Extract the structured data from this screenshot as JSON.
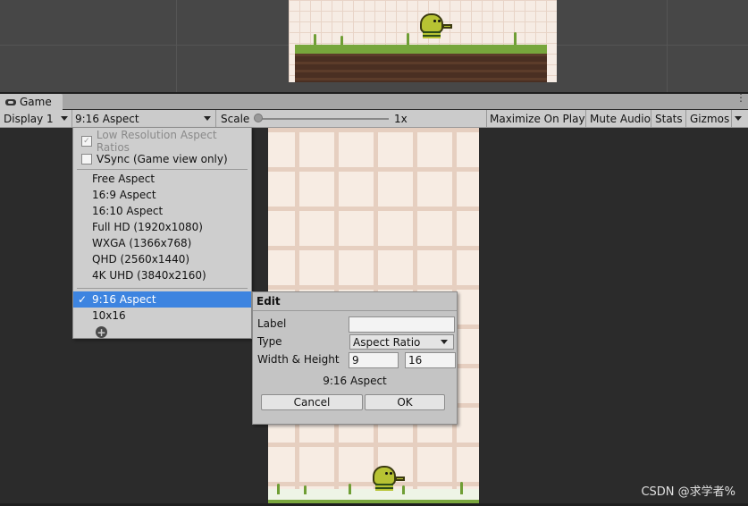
{
  "tab": {
    "title": "Game"
  },
  "toolbar": {
    "display": "Display 1",
    "aspect": "9:16 Aspect",
    "scale_label": "Scale",
    "scale_value": "1x",
    "maximize": "Maximize On Play",
    "mute": "Mute Audio",
    "stats": "Stats",
    "gizmos": "Gizmos"
  },
  "dropdown": {
    "low_res": "Low Resolution Aspect Ratios",
    "vsync": "VSync (Game view only)",
    "items": [
      "Free Aspect",
      "16:9 Aspect",
      "16:10 Aspect",
      "Full HD (1920x1080)",
      "WXGA (1366x768)",
      "QHD (2560x1440)",
      "4K UHD (3840x2160)"
    ],
    "custom_items": [
      "9:16 Aspect",
      "10x16"
    ],
    "check_glyph": "✓",
    "add_glyph": "+"
  },
  "edit": {
    "title": "Edit",
    "label_label": "Label",
    "label_value": "",
    "type_label": "Type",
    "type_value": "Aspect Ratio",
    "wh_label": "Width & Height",
    "width": "9",
    "height": "16",
    "preview": "9:16 Aspect",
    "cancel": "Cancel",
    "ok": "OK"
  },
  "watermark": "CSDN @求学者%",
  "colors": {
    "selected": "#3d84e0",
    "panel": "#cecece",
    "background": "#2b2b2b"
  }
}
